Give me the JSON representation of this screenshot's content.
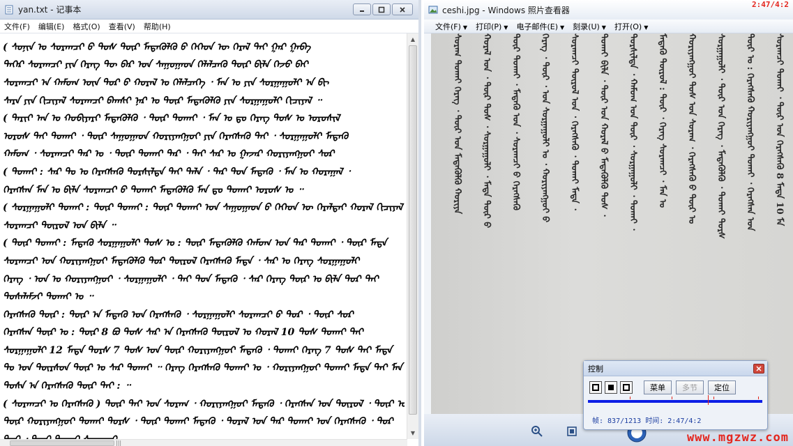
{
  "notepad": {
    "title": "yan.txt - 记事本",
    "menu": [
      "文件(F)",
      "编辑(E)",
      "格式(O)",
      "查看(V)",
      "帮助(H)"
    ],
    "lines": [
      "( ᠰᠣᠨᠢᠨ ᠤ ᠰᠤᠷᠠᠭᠴᠢ ᠪ ᠲᠤᠰ ᠲᠦᠷ ᠮᠡᠳᠡᠭᠦᠯᠬᠦ ᠪ ᠬᠡᠭᠡᠳ ᠦ ᠭᠡᠷᠡᠯ ᠲᠠᠢ ᠭᠠᠷ ᠭᠠᠪᠠ",
      "ᠲᠡᠭᠡᠷ ᠰᠤᠷᠠᠭᠴᠢ ᠶᠢᠨ ᠬᠡᠷᠡᠭ ᠲᠦ ᠪᠡᠷ ᠤᠨ ᠰᠠᠭᠤᠭᠠᠳ ᠬᠡᠯᠡᠯᠴᠡᠬᠦ ᠲᠦᠷ ᠪᠢᠯᠡ ᠭᠡᠵᠦ ᠪᠠᠢ",
      "ᠰᠤᠷᠠᠭᠴᠢ ᠠ ᠬᠠᠮᠤᠭ ᠦᠨ ᠳᠤᠷ ᠪ ᠬᠤᠷᠠᠯ ᠤ ᠬᠡᠯᠡᠯᠴᠡᠭᠡ ᠂ ᠮᠠᠨ ᠤ ᠶᠢᠨ ᠰᠤᠷᠭᠠᠭᠤᠯᠢ ᠠ ᠪᠢ",
      "ᠰᠠᠷᠠ ᠶᠢᠨ ᠬᠢᠴᠢᠶᠡᠯ ᠰᠤᠷᠠᠭᠴᠢ ᠪᠠᠭᠰᠢ ᠨᠠᠷ ᠤ ᠲᠦᠷ ᠮᠡᠳᠡᠭᠦᠯᠬᠦ ᠶᠢᠨ ᠰᠤᠷᠭᠠᠭᠤᠯᠢ ᠬᠢᠴᠢᠶᠡᠯ ᠃",
      "( ᠲᠠᠷᠢᠶ ᠠᠨ ᠤ ᠬᠤᠪᠢᠶᠠᠷᠢ ᠮᠡᠳᠡᠭᠦᠯᠬᠦ ᠂ ᠲᠦᠷ ᠲᠤᠬᠠᠢ ᠂ ᠮᠠᠨ ᠤ ᠳᠤ ᠬᠡᠷᠡᠭ ᠲᠤᠰ ᠤ ᠤᠷᠤᠰᠢᠯ",
      "ᠤᠷᠤᠰ ᠲᠡᠢ ᠲᠤᠬᠠᠢ ᠂ ᠲᠦᠷ ᠰᠠᠭᠤᠭᠠᠳ ᠬᠤᠷᠢᠶᠠᠩᠭᠤᠢ ᠶᠢᠨ ᠬᠡᠷᠡᠭᠰᠡᠬᠦ ᠲᠠᠢ ᠂ ᠰᠤᠷᠭᠠᠭᠤᠯᠢ ᠮᠡᠳᠡᠬᠦ",
      "ᠬᠠᠮᠤᠭ ᠂ ᠰᠤᠷᠠᠭᠴᠢ ᠲᠠᠷ ᠤ ᠂ ᠲᠦᠷ ᠲᠤᠬᠠᠢ ᠲᠠᠷ ᠂ ᠲᠠᠢ ᠰᠠᠷ ᠤ ᠭᠠᠵᠠᠷ ᠬᠤᠷᠢᠶᠠᠩᠭᠤᠢ ᠰᠤᠷ",
      "( ᠲᠤᠬᠠᠢ : ᠰᠠᠷ ᠲᠤ ᠤ ᠬᠡᠷᠡᠭᠰᠡᠬᠦ ᠲᠤᠷᠰᠢᠯᠲᠠ ᠲᠠᠢ ᠲᠠᠯᠠ ᠂ ᠳᠠᠷ ᠳᠤᠨ ᠮᠡᠳᠡᠬᠦ ᠂ ᠮᠠᠨ ᠤ ᠬᠤᠷᠠᠭᠠᠯ ᠂",
      "ᠬᠡᠷᠡᠭᠰᠡᠨ ᠮᠠᠨ ᠤ ᠪᠢᠯᠡ ᠰᠤᠷᠠᠭᠴᠢ ᠪ ᠲᠤᠬᠠᠢ ᠮᠡᠳᠡᠭᠦᠯᠬᠦ ᠮᠠᠨ ᠳᠤ ᠲᠤᠬᠠᠢ ᠤᠷᠤᠰ ᠤ ᠃",
      "( ᠰᠤᠷᠭᠠᠭᠤᠯᠢ ᠲᠤᠬᠠᠢ : ᠲᠦᠷ ᠲᠤᠬᠠᠢ : ᠲᠦᠷ ᠲᠤᠬᠠᠢ ᠤᠨ ᠰᠠᠭᠤᠭᠠᠳ ᠪ ᠬᠡᠭᠡᠳ ᠦ ᠭᠡᠷᠡᠯᠲᠡᠢ ᠬᠤᠷᠠᠯ ᠬᠢᠴᠢᠶᠡᠯ",
      "ᠰᠤᠷᠠᠭᠴᠢ ᠲᠦᠷᠦᠯ ᠤᠨ ᠪᠢᠯᠡ ᠃",
      "( ᠲᠦᠷ ᠲᠤᠬᠠᠢ : ᠮᠡᠳᠡᠬᠦ ᠰᠤᠷᠭᠠᠭᠤᠯᠢ ᠲᠤᠰ ᠤ : ᠲᠦᠷ ᠮᠡᠳᠡᠭᠦᠯᠬᠦ ᠬᠠᠮᠤᠭ ᠤᠨ ᠲᠠᠷ ᠲᠤᠬᠠᠢ ᠂ ᠲᠦᠷ ᠮᠡᠳᠡ",
      "ᠰᠤᠷᠠᠭᠴᠢ ᠤᠨ ᠬᠤᠷᠢᠶᠠᠩᠭᠤᠢ ᠮᠡᠳᠡᠭᠦᠯᠬᠦ ᠲᠤᠷ ᠲᠦᠷᠦᠯ ᠬᠡᠷᠡᠭᠰᠡᠬᠦ ᠮᠡᠳᠡ ᠂ ᠰᠠᠷ ᠤ ᠬᠡᠷᠡᠭ ᠰᠤᠷᠭᠠᠭᠤᠯᠢ",
      "ᠬᠡᠷᠡᠭ ᠂ ᠤᠨ ᠤ ᠬᠤᠷᠢᠶᠠᠩᠭᠤᠢ ᠂ ᠰᠤᠷᠭᠠᠭᠤᠯᠢ ᠂ ᠲᠠᠢ ᠳᠤᠨ ᠮᠡᠳᠡᠬᠦ ᠂ ᠰᠠᠷ ᠬᠡᠷᠡᠭ ᠲᠦᠷ ᠤ ᠪᠢᠯᠡ ᠲᠤᠷ ᠲᠠᠢ",
      "ᠲᠤᠰᠠᠯᠠᠮᠵᠢ ᠲᠤᠬᠠᠢ ᠤ ᠃",
      "ᠬᠡᠷᠡᠭᠰᠡᠬᠦ ᠲᠦᠷ : ᠲᠦᠷ ᠠ ᠮᠡᠳᠡᠬᠦ ᠤᠨ ᠬᠡᠷᠡᠭᠰᠡᠬᠦ ᠂ ᠰᠤᠷᠭᠠᠭᠤᠯᠢ ᠰᠤᠷᠠᠭᠴᠢ ᠪ ᠲᠤᠷ ᠂ ᠲᠦᠷ ᠰᠤᠷ",
      "ᠬᠡᠷᠡᠭᠰᠡᠨ ᠲᠦᠷ ᠤ : ᠲᠦᠷ 8 ᠪᠤ ᠲᠤᠰ ᠰᠠᠷ ᠠ ᠬᠡᠷᠡᠭᠰᠡᠬᠦ ᠲᠦᠷᠦᠯ ᠤ ᠬᠤᠷᠠᠯ 10 ᠲᠤᠰ ᠲᠤᠬᠠᠢ ᠲᠠᠢ",
      "ᠰᠤᠷᠭᠠᠭᠤᠯᠢ 12 ᠮᠡᠳᠡ ᠲᠤᠷᠰ 7 ᠲᠤᠰ ᠤᠨ ᠲᠦᠷ ᠬᠤᠷᠢᠶᠠᠩᠭᠤᠢ ᠮᠡᠳᠡᠭᠦ ᠂ ᠲᠤᠬᠠᠢ ᠬᠡᠷᠡᠭ 7 ᠲᠤᠰ ᠲᠠᠢ ᠮᠡᠳᠡ",
      "ᠲᠤ ᠤᠨ ᠲᠦᠷᠰᠦᠨ ᠲᠦᠷ ᠤ ᠰᠠᠷ ᠲᠤᠬᠠᠢ ᠃ ᠬᠡᠷᠡᠭ ᠬᠡᠷᠡᠭᠰᠡᠬᠦ ᠲᠤᠬᠠᠢ ᠤ ᠂ ᠬᠤᠷᠢᠶᠠᠩᠭᠤᠢ ᠲᠤᠬᠠᠢ ᠮᠡᠳᠡ ᠲᠠᠢ ᠮᠠᠨ",
      "ᠲᠤᠰᠠ ᠠ ᠬᠡᠷᠡᠭᠰᠡᠬᠦ ᠲᠦᠷ ᠲᠠᠢ : ᠃",
      "( ᠰᠤᠷᠠᠭᠴᠢ ᠤ ᠬᠡᠷᠡᠭᠰᠡᠬᠦ ) ᠲᠦᠷ ᠲᠠᠢ ᠤᠨ ᠰᠤᠷᠠᠭ ᠂ ᠬᠤᠷᠢᠶᠠᠩᠭᠤᠢ ᠮᠡᠳᠡᠭᠦ ᠂ ᠬᠡᠷᠡᠭᠰᠡᠨ ᠤᠨ ᠲᠦᠷᠦᠯ ᠂ ᠲᠦᠷ ᠤ",
      "ᠲᠦᠷ ᠬᠤᠷᠢᠶᠠᠩᠭᠤᠢ ᠲᠤᠬᠠᠢ ᠲᠤᠷᠰ ᠂ ᠲᠦᠷ ᠲᠤᠬᠠᠢ ᠮᠡᠳᠡᠬᠦ ᠂ ᠲᠤᠷᠠᠯ ᠤᠨ ᠲᠠᠷ ᠲᠤᠬᠠᠢ ᠤᠨ ᠬᠡᠷᠡᠭᠰᠡᠬᠦ ᠂ ᠲᠤᠷ",
      "ᠲᠤᠷ ᠂ ᠲᠦᠷ ᠲᠤᠬᠠᠢ ᠰᠤᠷᠠᠭᠴᠢ"
    ]
  },
  "viewer": {
    "title": "ceshi.jpg - Windows 照片查看器",
    "toolbar": [
      {
        "label": "文件(F)"
      },
      {
        "label": "打印(P)"
      },
      {
        "label": "电子邮件(E)"
      },
      {
        "label": "刻录(U)"
      },
      {
        "label": "打开(O)"
      }
    ],
    "photo_columns": [
      "ᠰᠤᠷᠠᠭᠴᠢ ᠲᠤᠬᠠᠢ ᠂ ᠲᠦᠷ ᠤᠨ ᠬᠡᠷᠡᠭᠰᠡᠬᠦ 8 ᠮᠡᠳᠡ 10 ᠮᠡ",
      "ᠲᠦᠷ ᠤ : ᠬᠡᠷᠡᠭᠰᠡᠬᠦ ᠬᠤᠷᠢᠶᠠᠩᠭᠤᠢ ᠲᠤᠬᠠᠢ ᠂ ᠬᠡᠷᠡᠭᠰᠡᠨ ᠤᠨ",
      "ᠰᠤᠷᠭᠠᠭᠤᠯᠢ ᠂ ᠲᠦᠷ ᠤᠨ ᠬᠡᠷᠡᠭ ᠂ ᠮᠡᠳᠡᠭᠦᠯᠬᠦ ᠂ ᠲᠤᠬᠠᠢ ᠲᠤᠷᠰ",
      "ᠬᠤᠷᠢᠶᠠᠩᠭᠤᠢ ᠲᠤᠰ ᠤᠨ ᠰᠤᠷᠠᠭ ᠂ ᠬᠡᠷᠡᠭᠰᠡᠬᠦ ᠪ ᠲᠦᠷ ᠤ",
      "ᠮᠡᠳᠡᠬᠦ ᠲᠦᠷᠦᠯ : ᠲᠦᠷ ᠂ ᠬᠡᠷᠡᠭ ᠰᠤᠷᠠᠭᠴᠢ ᠂ ᠮᠠᠨ ᠤ",
      "ᠲᠤᠷᠰᠢᠯᠲᠠ ᠂ ᠬᠠᠮᠤᠭ ᠤᠨ ᠲᠦᠷ ᠂ ᠰᠤᠷᠭᠠᠭᠤᠯᠢ ᠂ ᠲᠤᠬᠠᠢ ᠂",
      "ᠲᠤᠬᠠᠢ ᠪᠢᠯᠡ ᠂ ᠲᠦᠷ ᠤᠨ ᠬᠤᠷᠠᠯ ᠪ ᠮᠡᠳᠡᠭᠦᠯᠬᠦ ᠲᠤᠰ ᠂",
      "ᠰᠤᠷᠠᠭᠴᠢ ᠲᠦᠷᠦᠯ ᠤᠨ ᠂ ᠬᠡᠷᠡᠭᠰᠡᠬᠦ ᠂ ᠲᠤᠬᠠᠢ ᠮᠡᠳᠡ ᠂",
      "ᠬᠡᠷᠡᠭ ᠂ ᠲᠦᠷ ᠂ ᠤᠨ ᠰᠤᠷᠭᠠᠭᠤᠯᠢ ᠤ ᠂ ᠬᠤᠷᠢᠶᠠᠩᠭᠤᠢ ᠪ",
      "ᠲᠦᠷ ᠲᠤᠬᠠᠢ ᠂ ᠮᠡᠳᠡᠬᠦ ᠤᠨ ᠂ ᠰᠤᠷᠠᠭᠴᠢ ᠪ ᠬᠡᠷᠡᠭᠰᠡᠬᠦ",
      "ᠬᠤᠷᠠᠯ ᠤᠨ ᠂ ᠲᠦᠷ ᠲᠤᠰ ᠂ ᠰᠤᠷᠭᠠᠭᠤᠯᠢ ᠂ ᠮᠡᠳᠡ ᠲᠦᠷ ᠪ",
      "ᠰᠤᠷᠠᠭ ᠲᠤᠬᠠᠢ ᠬᠡᠷᠡᠭ ᠂ ᠲᠦᠷ ᠤᠨ ᠮᠡᠳᠡᠭᠦᠯᠬᠦ ᠬᠤᠷᠢᠶᠠ"
    ],
    "clock": "2:47/4:2"
  },
  "control": {
    "title": "控制",
    "buttons": {
      "menu": "菜单",
      "multi": "多节",
      "locate": "定位"
    },
    "status": "帧: 837/1213 时间: 2:47/4:2"
  },
  "watermark": "www.mgzwz.com",
  "colors": {
    "accent_red": "#e4261e",
    "track_blue": "#0c1ee6"
  },
  "icons": [
    "notepad-icon",
    "photo-icon",
    "minimize-icon",
    "maximize-icon",
    "close-icon",
    "zoom-icon",
    "fit-icon",
    "play-icon",
    "pause-icon",
    "stop-icon"
  ]
}
